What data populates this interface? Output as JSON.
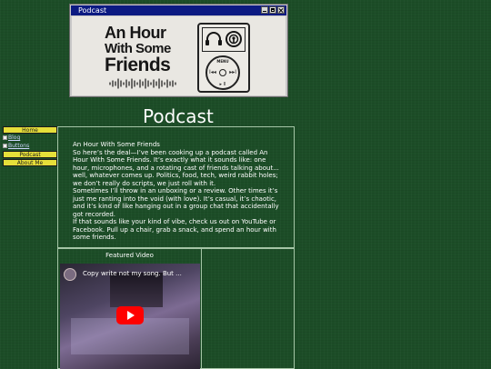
{
  "window": {
    "title": "Podcast"
  },
  "banner": {
    "line1": "An Hour",
    "line2": "With Some",
    "line3": "Friends",
    "player": {
      "menu": "MENU",
      "prev": "I◂◂",
      "next": "▸▸I",
      "play": "▸ II"
    }
  },
  "page": {
    "title": "Podcast"
  },
  "nav": {
    "home": "Home",
    "blog_alt": "Blog",
    "buttons_alt": "Buttons",
    "podcast": "Podcast",
    "about": "About Me"
  },
  "content": {
    "heading": "An Hour With Some Friends",
    "p1": "So here’s the deal—I’ve been cooking up a podcast called An Hour With Some Friends. It’s exactly what it sounds like: one hour, microphones, and a rotating cast of friends talking about... well, whatever comes up. Politics, food, tech, weird rabbit holes; we don’t really do scripts, we just roll with it.",
    "p2": "Sometimes I’ll throw in an unboxing or a review. Other times it’s just me ranting into the void (with love). It’s casual, it’s chaotic, and it’s kind of like hanging out in a group chat that accidentally got recorded.",
    "p3": "If that sounds like your kind of vibe, check us out on YouTube or Facebook. Pull up a chair, grab a snack, and spend an hour with some friends."
  },
  "video": {
    "label": "Featured Video",
    "title": "Copy write not my song. But ...",
    "icons": {
      "play": "play-icon",
      "avatar": "channel-avatar"
    },
    "colors": {
      "play_button": "#ff0000"
    }
  },
  "colors": {
    "background": "#1c4d27",
    "nav_button": "#e6df3a",
    "title_bar": "#0c1a82"
  }
}
